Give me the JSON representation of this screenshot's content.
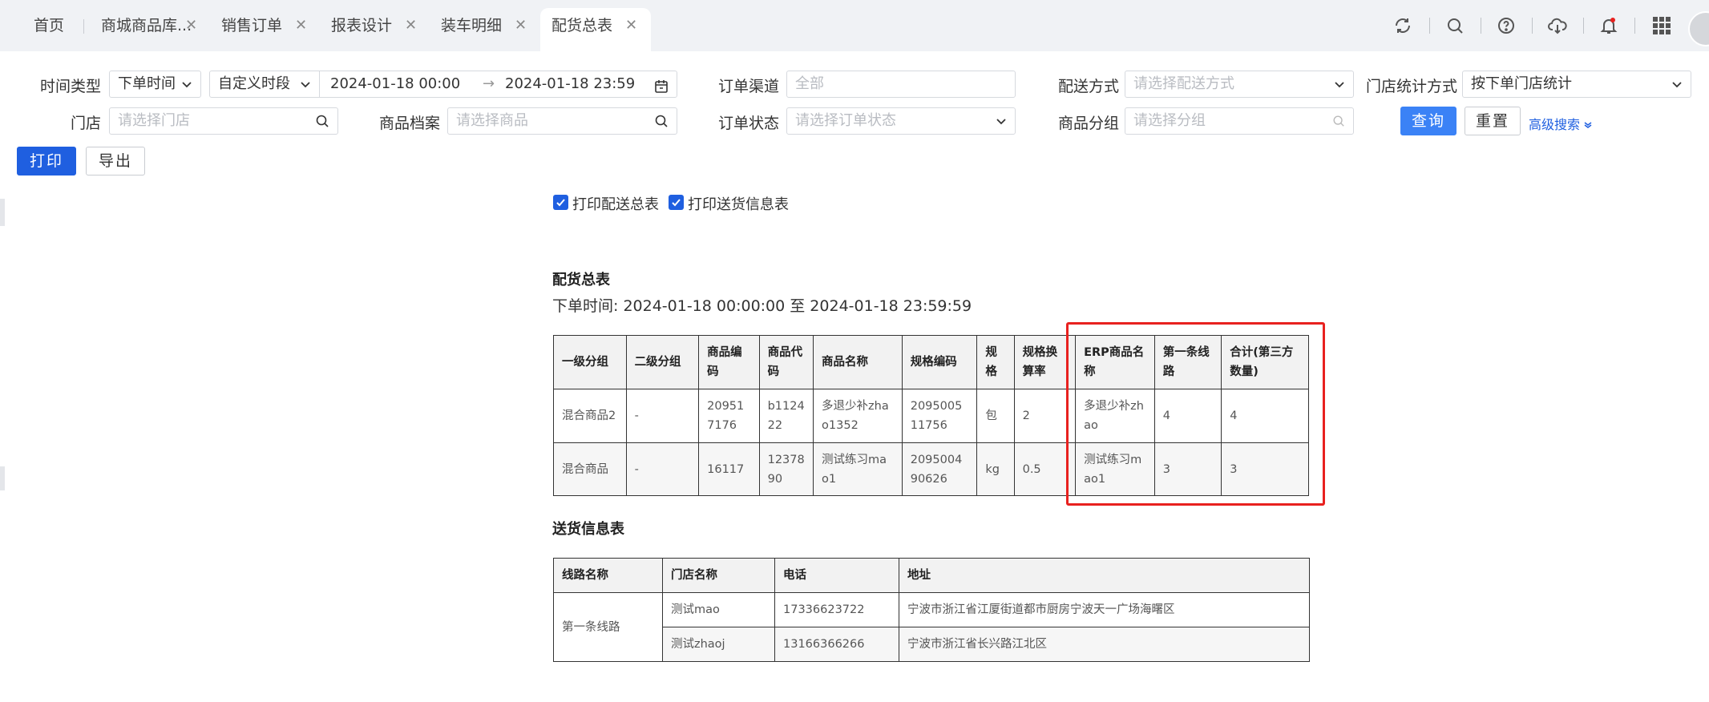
{
  "tabs": [
    {
      "label": "首页",
      "closable": false
    },
    {
      "label": "商城商品库...",
      "closable": true
    },
    {
      "label": "销售订单",
      "closable": true
    },
    {
      "label": "报表设计",
      "closable": true
    },
    {
      "label": "装车明细",
      "closable": true
    },
    {
      "label": "配货总表",
      "closable": true,
      "active": true
    }
  ],
  "header_icons": [
    "refresh-icon",
    "search-icon",
    "help-icon",
    "cloud-download-icon",
    "bell-icon",
    "apps-grid-icon",
    "avatar"
  ],
  "filters": {
    "time_type": {
      "label": "时间类型",
      "value": "下单时间"
    },
    "period": {
      "value": "自定义时段"
    },
    "date_start": "2024-01-18 00:00",
    "date_sep": "→",
    "date_end": "2024-01-18 23:59",
    "channel": {
      "label": "订单渠道",
      "placeholder": "全部"
    },
    "delivery": {
      "label": "配送方式",
      "placeholder": "请选择配送方式"
    },
    "store_stat": {
      "label": "门店统计方式",
      "value": "按下单门店统计"
    },
    "store": {
      "label": "门店",
      "placeholder": "请选择门店"
    },
    "product": {
      "label": "商品档案",
      "placeholder": "请选择商品"
    },
    "order_status": {
      "label": "订单状态",
      "placeholder": "请选择订单状态"
    },
    "group": {
      "label": "商品分组",
      "placeholder": "请选择分组"
    },
    "query_button": "查询",
    "reset_button": "重置",
    "advanced_search": "高级搜索"
  },
  "actions": {
    "print": "打印",
    "export": "导出"
  },
  "options": {
    "print_summary": {
      "label": "打印配送总表",
      "checked": true
    },
    "print_delivery": {
      "label": "打印送货信息表",
      "checked": true
    }
  },
  "report": {
    "title": "配货总表",
    "subtitle": "下单时间: 2024-01-18 00:00:00 至 2024-01-18 23:59:59",
    "headers": [
      "一级分组",
      "二级分组",
      "商品编码",
      "商品代码",
      "商品名称",
      "规格编码",
      "规格",
      "规格换算率",
      "ERP商品名称",
      "第一条线路",
      "合计(第三方数量)"
    ],
    "rows": [
      [
        "混合商品2",
        "-",
        "209517176",
        "b112422",
        "多退少补zhao1352",
        "209500511756",
        "包",
        "2",
        "多退少补zhao",
        "4",
        "4"
      ],
      [
        "混合商品",
        "-",
        "16117",
        "1237890",
        "测试练习mao1",
        "209500490626",
        "kg",
        "0.5",
        "测试练习mao1",
        "3",
        "3"
      ]
    ]
  },
  "delivery": {
    "title": "送货信息表",
    "headers": [
      "线路名称",
      "门店名称",
      "电话",
      "地址"
    ],
    "route": "第一条线路",
    "rows": [
      [
        "测试mao",
        "17336623722",
        "宁波市浙江省江厦街道都市厨房宁波天一广场海曙区"
      ],
      [
        "测试zhaoj",
        "13166366266",
        "宁波市浙江省长兴路江北区"
      ]
    ]
  },
  "colors": {
    "accent": "#1f5fe0",
    "highlight_border": "#e8211f"
  }
}
